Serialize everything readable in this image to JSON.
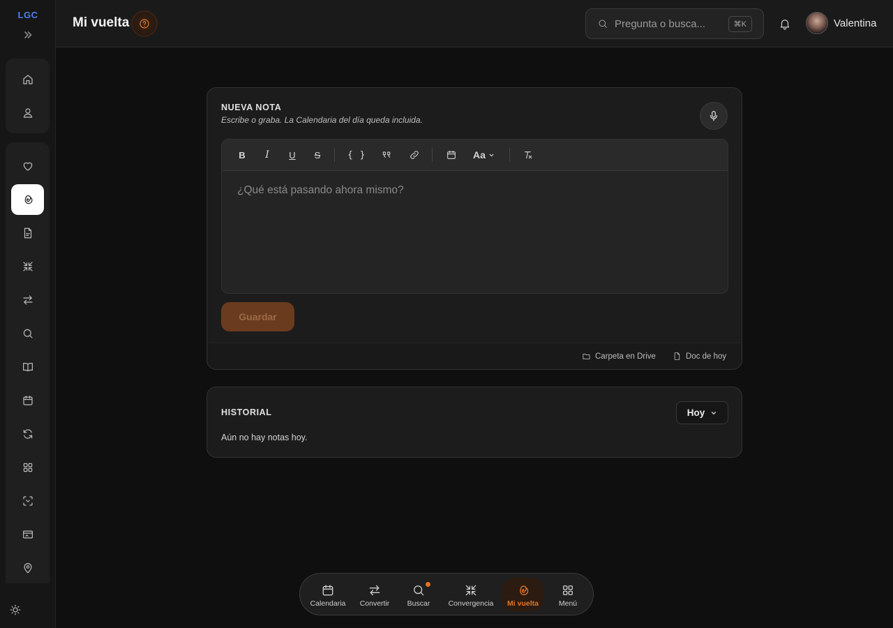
{
  "sidebar": {
    "logo": "LGC",
    "icons": [
      "home-icon",
      "user-icon",
      "heart-icon",
      "spiral-icon",
      "document-icon",
      "converge-icon",
      "swap-icon",
      "search-icon",
      "book-icon",
      "calendar-icon",
      "refresh-icon",
      "grid-icon",
      "scan-icon",
      "card-icon",
      "location-icon"
    ],
    "active_item": "spiral-icon"
  },
  "header": {
    "title": "Mi vuelta",
    "search_placeholder": "Pregunta o busca...",
    "search_shortcut": "⌘K",
    "user_name": "Valentina"
  },
  "note": {
    "title": "NUEVA NOTA",
    "subtitle": "Escribe o graba. La Calendaria del día queda incluida.",
    "toolbar": {
      "bold": "B",
      "italic": "I",
      "underline": "U",
      "strike": "S",
      "code": "{ }",
      "font_size": "Aa"
    },
    "placeholder": "¿Qué está pasando ahora mismo?",
    "save_label": "Guardar",
    "footer_links": {
      "drive": "Carpeta en Drive",
      "today_doc": "Doc de hoy"
    }
  },
  "history": {
    "title": "HISTORIAL",
    "filter": "Hoy",
    "empty_text": "Aún no hay notas hoy."
  },
  "dock": {
    "items": [
      {
        "label": "Calendaria"
      },
      {
        "label": "Convertir"
      },
      {
        "label": "Buscar"
      },
      {
        "label": "Convergencia"
      },
      {
        "label": "Mi vuelta"
      },
      {
        "label": "Menú"
      }
    ],
    "active": "Mi vuelta"
  },
  "colors": {
    "accent": "#e2762a",
    "logo": "#4f7df0",
    "background": "#0f0f0f",
    "card": "#1c1c1c"
  }
}
